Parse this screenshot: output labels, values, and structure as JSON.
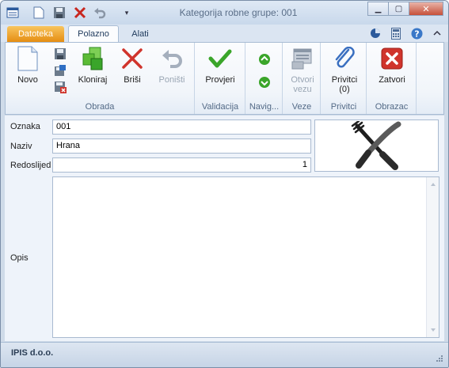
{
  "window": {
    "title": "Kategorija robne grupe: 001",
    "controls": {
      "minimize": "▁",
      "maximize": "▢",
      "close": "✕"
    }
  },
  "quick_access": [
    "app-menu-icon",
    "new-document-icon",
    "save-icon",
    "delete-icon",
    "undo-icon",
    "customize-dropdown-icon"
  ],
  "customize_arrow": "▾",
  "tabs": {
    "file": "Datoteka",
    "items": [
      {
        "label": "Polazno",
        "active": true
      },
      {
        "label": "Alati",
        "active": false
      }
    ]
  },
  "ribbon": {
    "groups": {
      "obrada": "Obrada",
      "validacija": "Validacija",
      "navigacija": "Navig...",
      "veze": "Veze",
      "privitci": "Privitci",
      "obrazac": "Obrazac"
    },
    "buttons": {
      "novo": "Novo",
      "kloniraj": "Kloniraj",
      "brisi": "Briši",
      "ponisti": "Poništi",
      "provjeri": "Provjeri",
      "otvori_line1": "Otvori",
      "otvori_line2": "vezu",
      "privitci_line1": "Privitci",
      "privitci_line2": "(0)",
      "zatvori": "Zatvori"
    }
  },
  "form": {
    "oznaka": {
      "label": "Oznaka",
      "value": "001"
    },
    "naziv": {
      "label": "Naziv",
      "value": "Hrana"
    },
    "redoslijed": {
      "label": "Redoslijed",
      "value": "1"
    },
    "opis": {
      "label": "Opis",
      "value": ""
    },
    "image_icon": "fork-knife-icon"
  },
  "status": {
    "company": "IPIS d.o.o."
  },
  "colors": {
    "file_tab": "#e58d12",
    "accent_green": "#3aa52a",
    "delete_red": "#d0342c",
    "ribbon_border": "#a8bcd4"
  }
}
